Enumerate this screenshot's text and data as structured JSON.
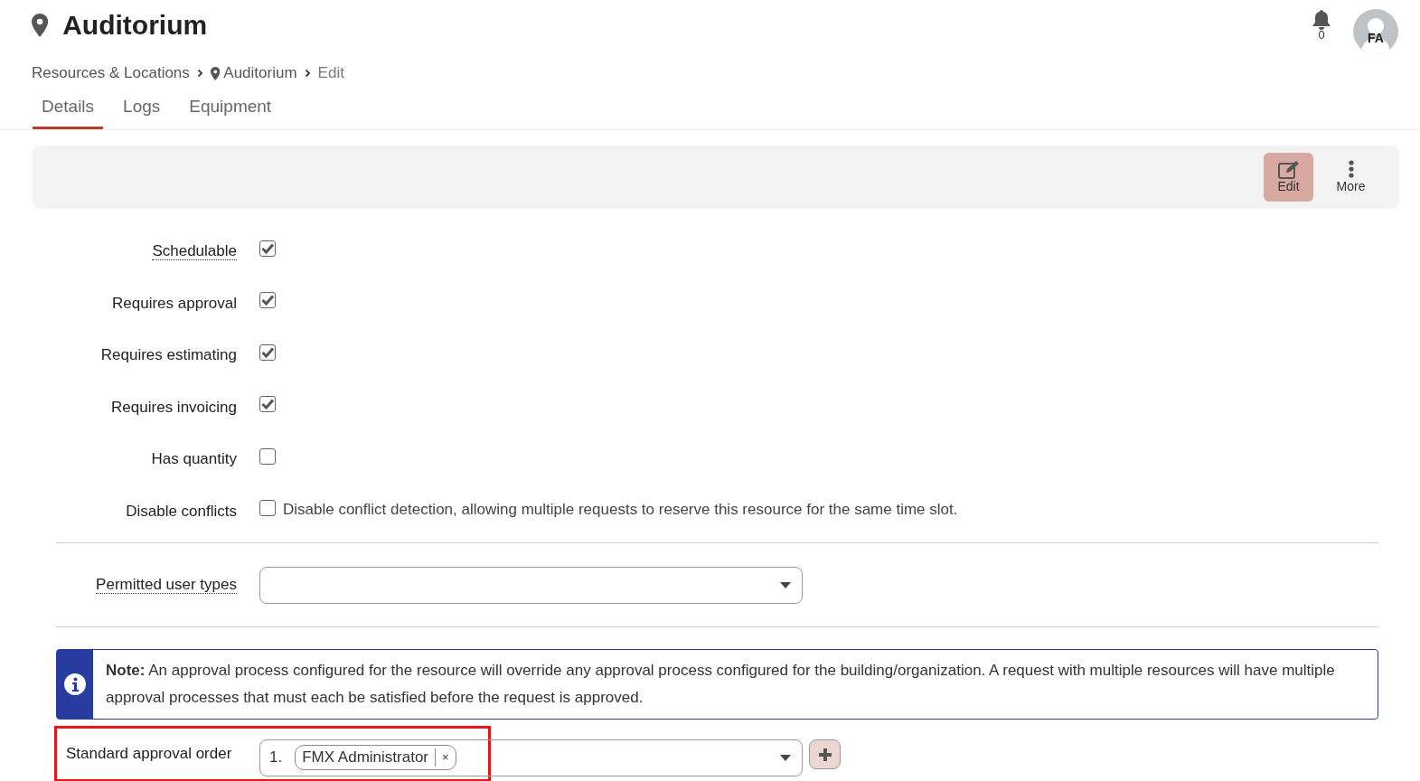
{
  "header": {
    "title": "Auditorium",
    "notifications": "0",
    "avatar_initials": "FA"
  },
  "breadcrumb": [
    {
      "label": "Resources & Locations",
      "kind": "link"
    },
    {
      "label": "Auditorium",
      "kind": "location"
    },
    {
      "label": "Edit",
      "kind": "current"
    }
  ],
  "tabs": [
    {
      "label": "Details",
      "selected": true
    },
    {
      "label": "Logs",
      "selected": false
    },
    {
      "label": "Equipment",
      "selected": false
    }
  ],
  "toolbar": [
    {
      "label": "Edit",
      "kind": "edit",
      "selected": true
    },
    {
      "label": "More",
      "kind": "more",
      "selected": false
    }
  ],
  "checkbox_fields": [
    {
      "label": "Schedulable",
      "has_tooltip": true,
      "checked": true
    },
    {
      "label": "Requires approval",
      "has_tooltip": false,
      "checked": true
    },
    {
      "label": "Requires estimating",
      "has_tooltip": false,
      "checked": true
    },
    {
      "label": "Requires invoicing",
      "has_tooltip": false,
      "checked": true
    },
    {
      "label": "Has quantity",
      "has_tooltip": false,
      "checked": false
    },
    {
      "label": "Disable conflicts",
      "has_tooltip": false,
      "checked": false,
      "description": "Disable conflict detection, allowing multiple requests to reserve this resource for the same time slot."
    }
  ],
  "permitted_user_types": {
    "label": "Permitted user types",
    "has_tooltip": true
  },
  "note": "**Note:** An approval process configured for the resource will override any approval process configured for the building/organization. A request with multiple resources will have multiple approval processes that must each be satisfied before the request is approved.",
  "standard_approval_order": {
    "label": "Standard approval order",
    "highlighted": true,
    "items": [
      {
        "number": "1.",
        "name": "FMX Administrator",
        "remove_symbol": "×"
      }
    ]
  }
}
